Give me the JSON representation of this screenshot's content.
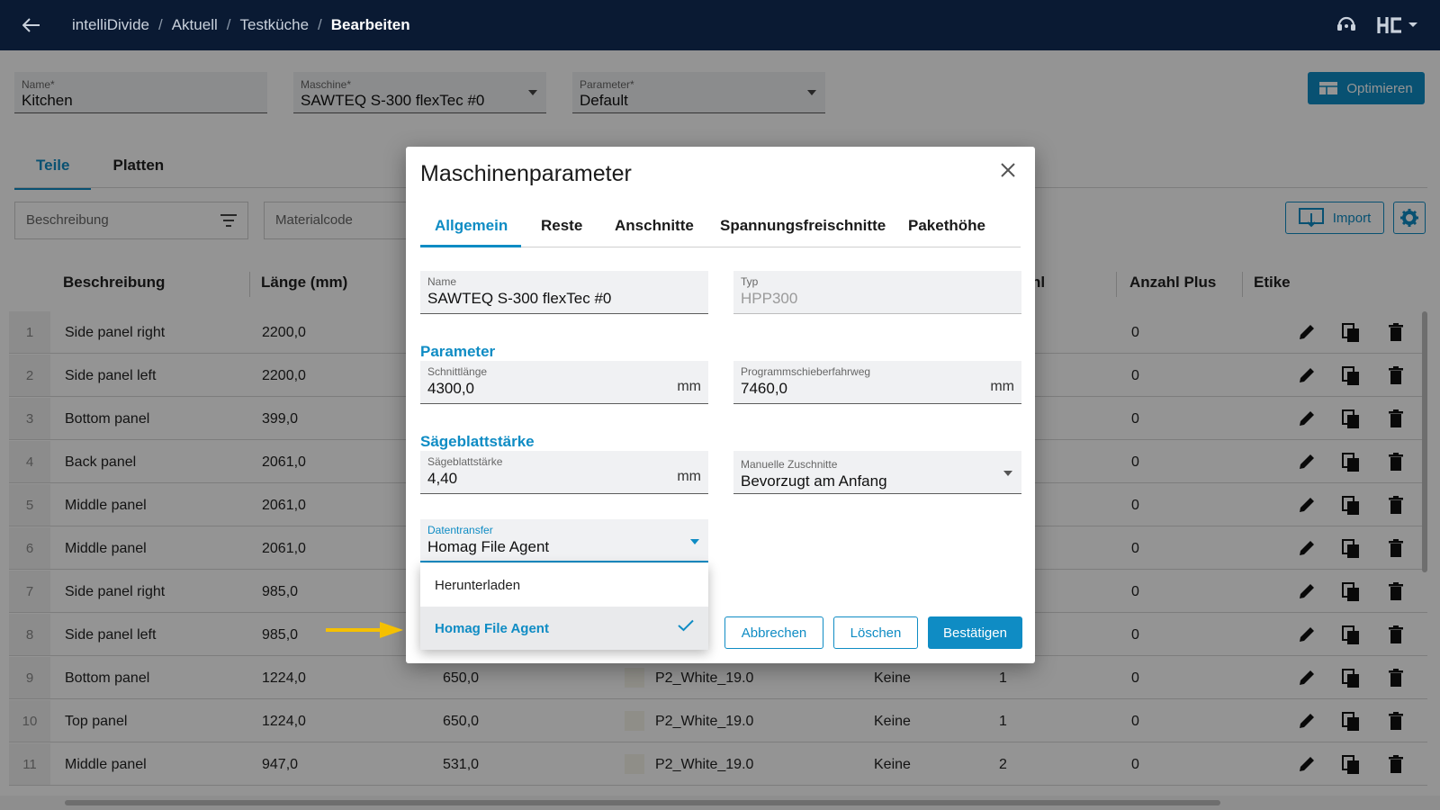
{
  "breadcrumb": [
    "intelliDivide",
    "Aktuell",
    "Testküche",
    "Bearbeiten"
  ],
  "header_fields": {
    "name": {
      "label": "Name*",
      "value": "Kitchen"
    },
    "machine": {
      "label": "Maschine*",
      "value": "SAWTEQ S-300 flexTec #0"
    },
    "parameter": {
      "label": "Parameter*",
      "value": "Default"
    }
  },
  "optimize_label": "Optimieren",
  "page_tabs": [
    "Teile",
    "Platten"
  ],
  "filters": {
    "description_placeholder": "Beschreibung",
    "material_placeholder": "Materialcode"
  },
  "import_label": "Import",
  "table": {
    "columns": [
      "Beschreibung",
      "Länge (mm)",
      "hl",
      "Anzahl Plus",
      "Etike"
    ],
    "rows": [
      {
        "n": "1",
        "desc": "Side panel right",
        "len": "2200,0",
        "wid": "",
        "mat": "",
        "grain": "",
        "qty": "",
        "plus": "0"
      },
      {
        "n": "2",
        "desc": "Side panel left",
        "len": "2200,0",
        "wid": "",
        "mat": "",
        "grain": "",
        "qty": "",
        "plus": "0"
      },
      {
        "n": "3",
        "desc": "Bottom panel",
        "len": "399,0",
        "wid": "",
        "mat": "",
        "grain": "",
        "qty": "",
        "plus": "0"
      },
      {
        "n": "4",
        "desc": "Back panel",
        "len": "2061,0",
        "wid": "",
        "mat": "",
        "grain": "",
        "qty": "",
        "plus": "0"
      },
      {
        "n": "5",
        "desc": "Middle panel",
        "len": "2061,0",
        "wid": "",
        "mat": "",
        "grain": "",
        "qty": "",
        "plus": "0"
      },
      {
        "n": "6",
        "desc": "Middle panel",
        "len": "2061,0",
        "wid": "",
        "mat": "",
        "grain": "",
        "qty": "",
        "plus": "0"
      },
      {
        "n": "7",
        "desc": "Side panel right",
        "len": "985,0",
        "wid": "",
        "mat": "",
        "grain": "",
        "qty": "",
        "plus": "0"
      },
      {
        "n": "8",
        "desc": "Side panel left",
        "len": "985,0",
        "wid": "",
        "mat": "",
        "grain": "",
        "qty": "",
        "plus": "0"
      },
      {
        "n": "9",
        "desc": "Bottom panel",
        "len": "1224,0",
        "wid": "650,0",
        "mat": "P2_White_19.0",
        "grain": "Keine",
        "qty": "1",
        "plus": "0"
      },
      {
        "n": "10",
        "desc": "Top panel",
        "len": "1224,0",
        "wid": "650,0",
        "mat": "P2_White_19.0",
        "grain": "Keine",
        "qty": "1",
        "plus": "0"
      },
      {
        "n": "11",
        "desc": "Middle panel",
        "len": "947,0",
        "wid": "531,0",
        "mat": "P2_White_19.0",
        "grain": "Keine",
        "qty": "2",
        "plus": "0"
      }
    ]
  },
  "dialog": {
    "title": "Maschinenparameter",
    "tabs": [
      "Allgemein",
      "Reste",
      "Anschnitte",
      "Spannungsfreischnitte",
      "Pakethöhe"
    ],
    "name": {
      "label": "Name",
      "value": "SAWTEQ S-300 flexTec #0"
    },
    "type": {
      "label": "Typ",
      "value": "HPP300"
    },
    "section_parameter": "Parameter",
    "cut_length": {
      "label": "Schnittlänge",
      "value": "4300,0",
      "unit": "mm"
    },
    "pusher_travel": {
      "label": "Programmschieberfahrweg",
      "value": "7460,0",
      "unit": "mm"
    },
    "section_blade": "Sägeblattstärke",
    "blade_thickness": {
      "label": "Sägeblattstärke",
      "value": "4,40",
      "unit": "mm"
    },
    "manual_cuts": {
      "label": "Manuelle Zuschnitte",
      "value": "Bevorzugt am Anfang"
    },
    "data_transfer": {
      "label": "Datentransfer",
      "value": "Homag File Agent"
    },
    "dropdown_options": [
      "Herunterladen",
      "Homag File Agent"
    ],
    "buttons": {
      "cancel": "Abbrechen",
      "delete": "Löschen",
      "confirm": "Bestätigen"
    }
  },
  "colors": {
    "accent": "#0f8cc4",
    "topbar": "#0a1a33",
    "arrow": "#f5c000"
  }
}
